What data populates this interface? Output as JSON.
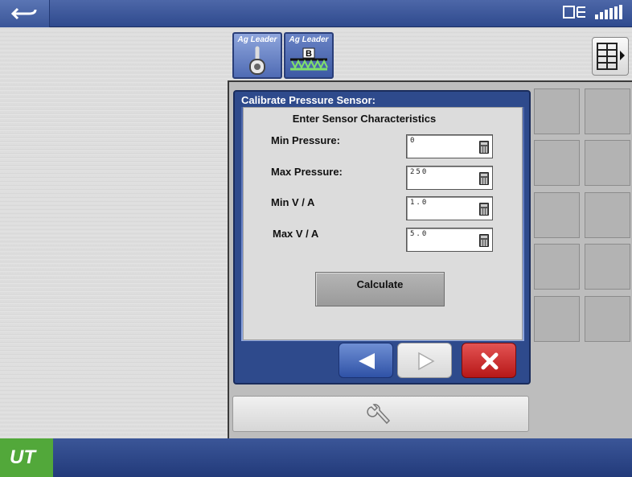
{
  "topbar": {
    "back_icon": "undo-arrow-icon",
    "status_icons": [
      "display-status-icon",
      "signal-bars-icon"
    ]
  },
  "tabs": [
    {
      "label": "Ag Leader",
      "icon": "toggle-switch-icon",
      "active": true
    },
    {
      "label": "Ag Leader",
      "icon": "boom-section-icon",
      "badge": "B",
      "active": false
    }
  ],
  "grid_button": {
    "icon": "grid-menu-icon"
  },
  "dialog": {
    "title": "Calibrate Pressure Sensor:",
    "subtitle": "Enter Sensor Characteristics",
    "fields": [
      {
        "label": "Min Pressure:",
        "value": "0"
      },
      {
        "label": "Max Pressure:",
        "value": "250"
      },
      {
        "label": "Min V / A",
        "value": "1.0"
      },
      {
        "label": "Max V / A",
        "value": "5.0"
      }
    ],
    "calculate_label": "Calculate"
  },
  "colors": {
    "accent": "#2e4a8c",
    "cancel": "#c52222",
    "brand_green": "#52a83a"
  },
  "bottombar": {
    "logo_text": "UT"
  }
}
